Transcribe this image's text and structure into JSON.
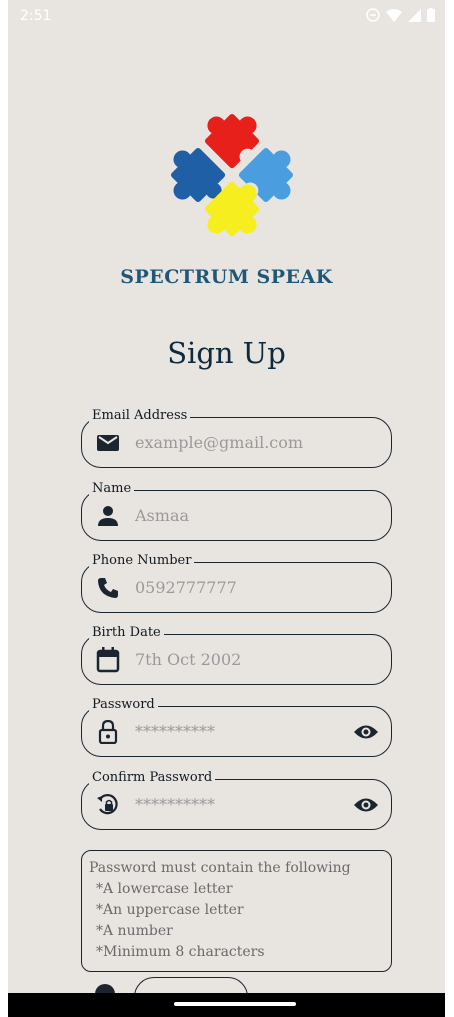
{
  "status_bar": {
    "time": "2:51"
  },
  "app": {
    "brand": "SPECTRUM SPEAK",
    "title": "Sign Up"
  },
  "form": {
    "email": {
      "label": "Email Address",
      "placeholder": "example@gmail.com",
      "icon": "mail-icon"
    },
    "name": {
      "label": "Name",
      "value": "Asmaa",
      "icon": "person-icon"
    },
    "phone": {
      "label": "Phone Number",
      "value": "0592777777",
      "icon": "phone-icon"
    },
    "birth_date": {
      "label": "Birth Date",
      "value": "7th Oct 2002",
      "icon": "calendar-icon"
    },
    "password": {
      "label": "Password",
      "value": "**********",
      "icon": "lock-icon",
      "trailing_icon": "eye-icon"
    },
    "confirm_password": {
      "label": "Confirm Password",
      "value": "**********",
      "icon": "lock-reset-icon",
      "trailing_icon": "eye-icon"
    }
  },
  "password_rules": {
    "heading": "Password must contain the following",
    "items": [
      "*A lowercase letter",
      "*An uppercase letter",
      "*A number",
      "*Minimum 8 characters"
    ]
  },
  "colors": {
    "background": "#e8e4e0",
    "brand": "#1f5877",
    "title": "#0e2a3d",
    "border": "#1b2530",
    "placeholder": "#9a9a9a",
    "puzzle_red": "#e8201c",
    "puzzle_blue_dark": "#1e5fa6",
    "puzzle_blue_light": "#4a9ee0",
    "puzzle_yellow": "#f7ee1f"
  }
}
